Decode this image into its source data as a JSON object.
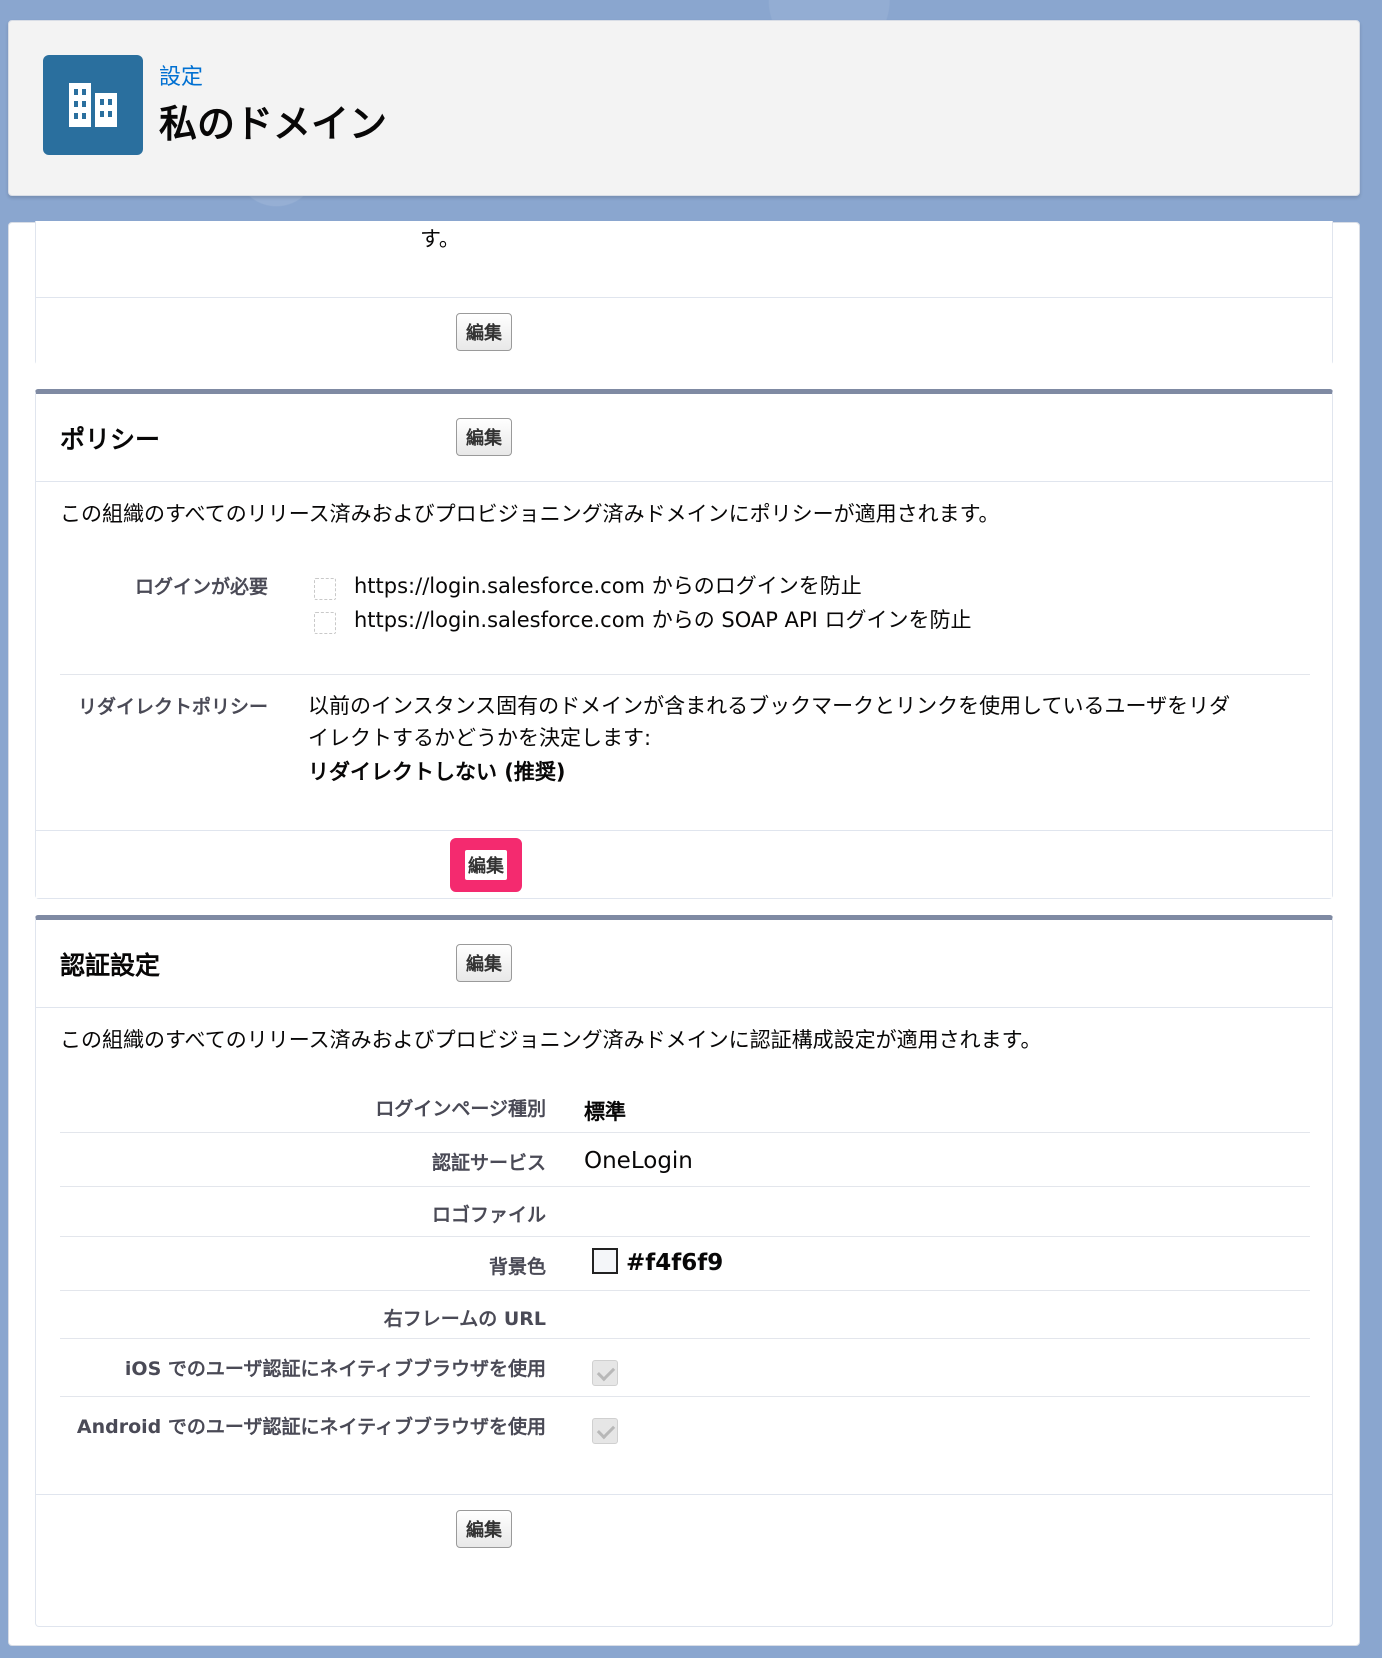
{
  "header": {
    "breadcrumb": "設定",
    "title": "私のドメイン",
    "icon": "building-icon",
    "icon_color": "#2a6f9e"
  },
  "top_section": {
    "trailing_text": "す。",
    "edit_label": "編集"
  },
  "policy": {
    "title": "ポリシー",
    "edit_label": "編集",
    "description": "この組織のすべてのリリース済みおよびプロビジョニング済みドメインにポリシーが適用されます。",
    "login_required_label": "ログインが必要",
    "login_options": [
      {
        "label": "https://login.salesforce.com からのログインを防止",
        "checked": false
      },
      {
        "label": "https://login.salesforce.com からの SOAP API ログインを防止",
        "checked": false
      }
    ],
    "redirect_label": "リダイレクトポリシー",
    "redirect_description_line1": "以前のインスタンス固有のドメインが含まれるブックマークとリンクを使用しているユーザをリダ",
    "redirect_description_line2": "イレクトするかどうかを決定します:",
    "redirect_value": "リダイレクトしない (推奨)",
    "footer_edit_label": "編集",
    "highlight_color": "#f42a6f"
  },
  "auth": {
    "title": "認証設定",
    "edit_label": "編集",
    "description": "この組織のすべてのリリース済みおよびプロビジョニング済みドメインに認証構成設定が適用されます。",
    "fields": {
      "login_page_type_label": "ログインページ種別",
      "login_page_type_value": "標準",
      "auth_service_label": "認証サービス",
      "auth_service_value": "OneLogin",
      "logo_file_label": "ロゴファイル",
      "logo_file_value": "",
      "bg_color_label": "背景色",
      "bg_color_value": "#f4f6f9",
      "right_frame_label": "右フレームの URL",
      "right_frame_value": "",
      "ios_native_label": "iOS でのユーザ認証にネイティブブラウザを使用",
      "ios_native_checked": true,
      "android_native_label": "Android でのユーザ認証にネイティブブラウザを使用",
      "android_native_checked": true
    },
    "footer_edit_label": "編集"
  }
}
